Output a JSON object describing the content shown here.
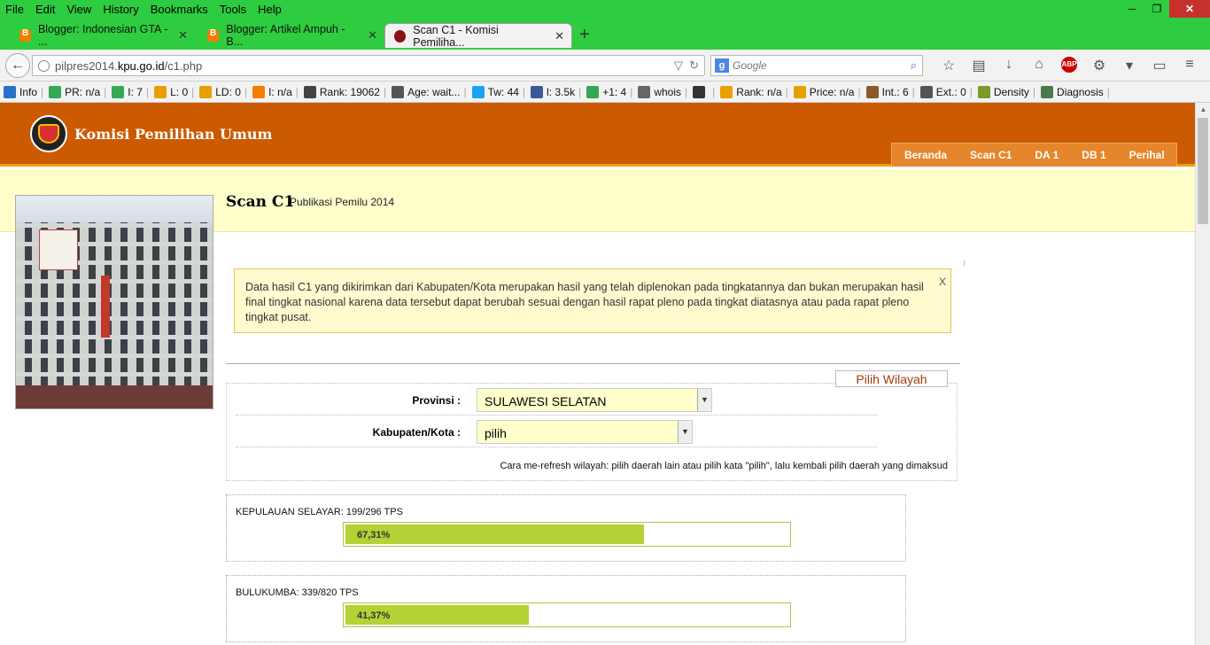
{
  "browser": {
    "menu": [
      "File",
      "Edit",
      "View",
      "History",
      "Bookmarks",
      "Tools",
      "Help"
    ],
    "tabs": [
      {
        "title": "Blogger: Indonesian GTA - ..."
      },
      {
        "title": "Blogger: Artikel Ampuh - B..."
      },
      {
        "title": "Scan C1 - Komisi Pemiliha..."
      }
    ],
    "url_prefix": "pilpres2014.",
    "url_host": "kpu.go.id",
    "url_path": "/c1.php",
    "search_placeholder": "Google",
    "bookmarks": [
      {
        "label": "Info",
        "color": "#2a6fc9"
      },
      {
        "label": "PR: n/a",
        "color": "#34a853"
      },
      {
        "label": "I: 7",
        "color": "#34a853"
      },
      {
        "label": "L: 0",
        "color": "#e8a000"
      },
      {
        "label": "LD: 0",
        "color": "#e8a000"
      },
      {
        "label": "I: n/a",
        "color": "#f57d00"
      },
      {
        "label": "Rank: 19062",
        "color": "#444444"
      },
      {
        "label": "Age: wait...",
        "color": "#555555"
      },
      {
        "label": "Tw: 44",
        "color": "#1da1f2"
      },
      {
        "label": "l: 3.5k",
        "color": "#3b5998"
      },
      {
        "label": "+1: 4",
        "color": "#34a853"
      },
      {
        "label": "whois",
        "color": "#666666"
      },
      {
        "label": "",
        "color": "#333333"
      },
      {
        "label": "Rank: n/a",
        "color": "#e8a000"
      },
      {
        "label": "Price: n/a",
        "color": "#e8a000"
      },
      {
        "label": "Int.: 6",
        "color": "#8a5a2a"
      },
      {
        "label": "Ext.: 0",
        "color": "#555555"
      },
      {
        "label": "Density",
        "color": "#7a9a2a"
      },
      {
        "label": "Diagnosis",
        "color": "#4a7a4a"
      }
    ]
  },
  "site": {
    "title": "Komisi Pemilihan Umum",
    "nav": [
      "Beranda",
      "Scan C1",
      "DA 1",
      "DB 1",
      "Perihal"
    ],
    "page_title": "Scan C1",
    "page_subtitle": "Publikasi Pemilu 2014",
    "notice": "Data hasil C1 yang dikirimkan dari Kabupaten/Kota merupakan hasil yang telah diplenokan pada tingkatannya dan bukan merupakan hasil final tingkat nasional karena data tersebut dapat berubah sesuai dengan hasil rapat pleno pada tingkat diatasnya atau pada rapat pleno tingkat pusat.",
    "notice_close": "X",
    "wilayah_button": "Pilih Wilayah",
    "provinsi_label": "Provinsi :",
    "provinsi_value": "SULAWESI SELATAN",
    "kabupaten_label": "Kabupaten/Kota :",
    "kabupaten_value": "pilih",
    "refresh_hint": "Cara me-refresh wilayah: pilih daerah lain atau pilih kata \"pilih\", lalu kembali pilih daerah yang dimaksud",
    "progress": [
      {
        "label": "KEPULAUAN SELAYAR: 199/296 TPS",
        "pct_text": "67,31%",
        "pct": 67.31
      },
      {
        "label": "BULUKUMBA: 339/820 TPS",
        "pct_text": "41,37%",
        "pct": 41.37
      }
    ]
  }
}
